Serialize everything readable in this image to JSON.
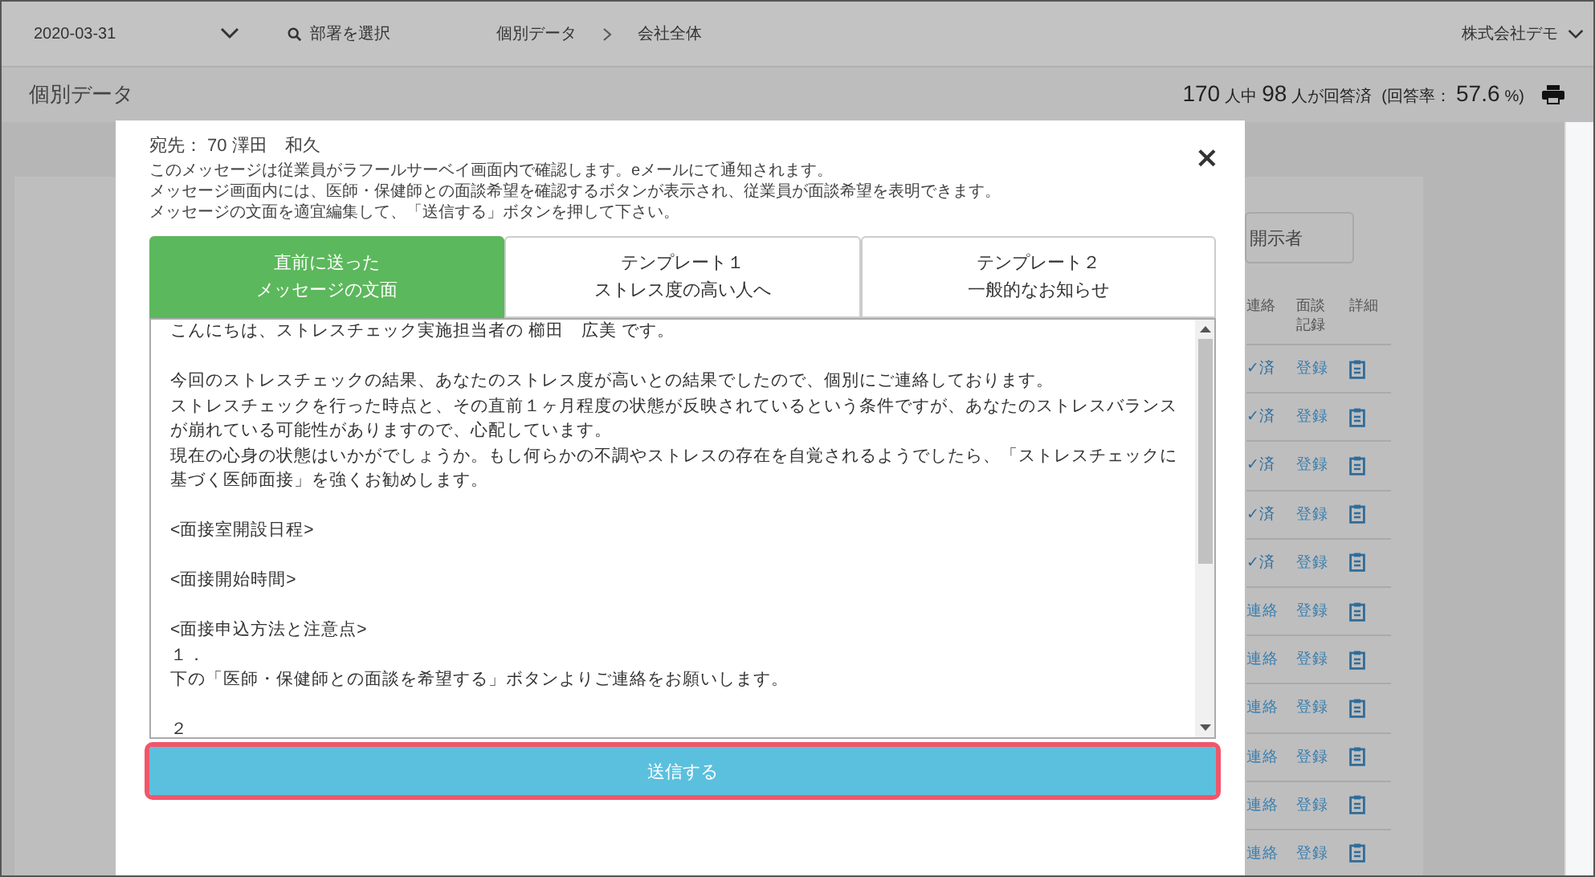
{
  "header": {
    "date": "2020-03-31",
    "department_search": {
      "placeholder": "部署を選択"
    },
    "breadcrumb": [
      "個別データ",
      "会社全体"
    ],
    "company": "株式会社デモ"
  },
  "subheader": {
    "title": "個別データ",
    "stats": [
      {
        "text": "170",
        "kind": "number"
      },
      {
        "text": "人中",
        "kind": "unit"
      },
      {
        "text": "98",
        "kind": "number"
      },
      {
        "text": "人が回答済",
        "kind": "unit"
      },
      {
        "text": "(回答率：",
        "kind": "unit"
      },
      {
        "text": "57.6",
        "kind": "number"
      },
      {
        "text": "%)",
        "kind": "unit"
      }
    ]
  },
  "background_table": {
    "filter_button": "開示者",
    "columns": [
      "連絡",
      "面談記録",
      "詳細"
    ],
    "rows": [
      {
        "contact": "✓済",
        "kind": "done",
        "record": "登録"
      },
      {
        "contact": "✓済",
        "kind": "done",
        "record": "登録"
      },
      {
        "contact": "✓済",
        "kind": "done",
        "record": "登録"
      },
      {
        "contact": "✓済",
        "kind": "done",
        "record": "登録"
      },
      {
        "contact": "✓済",
        "kind": "done",
        "record": "登録"
      },
      {
        "contact": "連絡",
        "kind": "pending",
        "record": "登録"
      },
      {
        "contact": "連絡",
        "kind": "pending",
        "record": "登録"
      },
      {
        "contact": "連絡",
        "kind": "pending",
        "record": "登録"
      },
      {
        "contact": "連絡",
        "kind": "pending",
        "record": "登録"
      },
      {
        "contact": "連絡",
        "kind": "pending",
        "record": "登録"
      },
      {
        "contact": "連絡",
        "kind": "pending",
        "record": "登録"
      }
    ]
  },
  "modal": {
    "recipient": "宛先： 70 澤田　和久",
    "close": "×",
    "notes": [
      "このメッセージは従業員がラフールサーベイ画面内で確認します。eメールにて通知されます。",
      "メッセージ画面内には、医師・保健師との面談希望を確認するボタンが表示され、従業員が面談希望を表明できます。",
      "メッセージの文面を適宜編集して、「送信する」ボタンを押して下さい。"
    ],
    "tabs": [
      {
        "lines": [
          "直前に送った",
          "メッセージの文面"
        ],
        "selected": true
      },
      {
        "lines": [
          "テンプレート１",
          "ストレス度の高い人へ"
        ],
        "selected": false
      },
      {
        "lines": [
          "テンプレート２",
          "一般的なお知らせ"
        ],
        "selected": false
      }
    ],
    "message": [
      [
        "こんにちは、ストレスチェック実施担当者の 櫛田　広美 です。"
      ],
      [
        "今回のストレスチェックの結果、あなたのストレス度が高いとの結果でしたので、個別にご連絡しております。",
        "ストレスチェックを行った時点と、その直前１ヶ月程度の状態が反映されているという条件ですが、あなたのストレスバランスが崩れている可能性がありますので、心配しています。",
        "現在の心身の状態はいかがでしょうか。もし何らかの不調やストレスの存在を自覚されるようでしたら、「ストレスチェックに基づく医師面接」を強くお勧めします。"
      ],
      [
        "<面接室開設日程>"
      ],
      [
        "<面接開始時間>"
      ],
      [
        "<面接申込方法と注意点>",
        "１．",
        "下の「医師・保健師との面談を希望する」ボタンよりご連絡をお願いします。"
      ],
      [
        "２"
      ]
    ],
    "send_button": "送信する"
  }
}
